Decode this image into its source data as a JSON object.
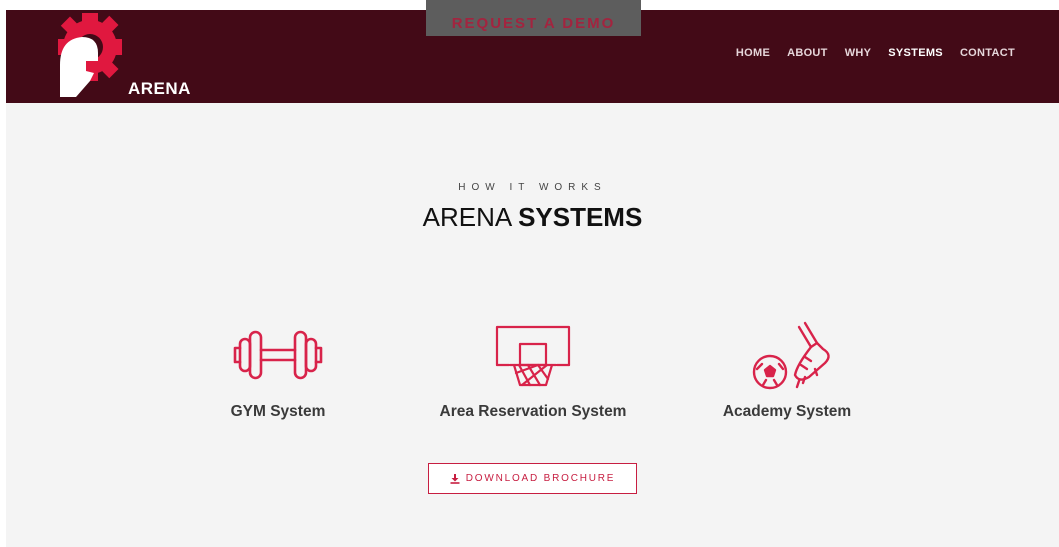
{
  "brand": {
    "name": "ARENA",
    "logo_icon": "spartan-helmet-gear-icon"
  },
  "header": {
    "demo_button": "REQUEST A DEMO",
    "nav": [
      {
        "label": "HOME",
        "active": false
      },
      {
        "label": "ABOUT",
        "active": false
      },
      {
        "label": "WHY",
        "active": false
      },
      {
        "label": "SYSTEMS",
        "active": true
      },
      {
        "label": "CONTACT",
        "active": false
      }
    ]
  },
  "section": {
    "eyebrow": "HOW IT WORKS",
    "title_light": "ARENA",
    "title_bold": "SYSTEMS"
  },
  "systems": [
    {
      "label": "GYM System",
      "icon": "dumbbell-icon"
    },
    {
      "label": "Area Reservation System",
      "icon": "basketball-hoop-icon"
    },
    {
      "label": "Academy System",
      "icon": "soccer-ball-boot-icon"
    }
  ],
  "brochure_button": {
    "label": "DOWNLOAD BROCHURE",
    "icon": "download-icon"
  },
  "colors": {
    "nav_bg": "#430a17",
    "accent": "#c71e41",
    "page_bg": "#f4f4f4",
    "demo_bg": "#5d5d5d"
  }
}
